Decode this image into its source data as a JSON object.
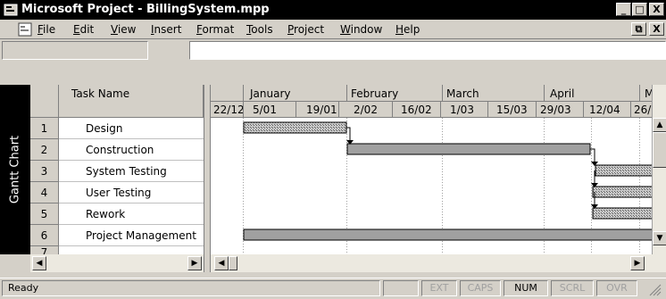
{
  "window": {
    "title": "Microsoft Project - BillingSystem.mpp",
    "caption_buttons": [
      "_",
      "□",
      "X"
    ]
  },
  "menu": {
    "items": [
      "File",
      "Edit",
      "View",
      "Insert",
      "Format",
      "Tools",
      "Project",
      "Window",
      "Help"
    ],
    "mdi_buttons": [
      "⧉",
      "X"
    ]
  },
  "view_bar": {
    "label": "Gantt Chart"
  },
  "table": {
    "header": "Task Name",
    "rows": [
      {
        "id": "1",
        "name": "Design"
      },
      {
        "id": "2",
        "name": "Construction"
      },
      {
        "id": "3",
        "name": "System Testing"
      },
      {
        "id": "4",
        "name": "User Testing"
      },
      {
        "id": "5",
        "name": "Rework"
      },
      {
        "id": "6",
        "name": "Project Management"
      },
      {
        "id": "7",
        "name": ""
      }
    ]
  },
  "timescale": {
    "months": [
      "January",
      "February",
      "March",
      "April",
      "M"
    ],
    "weeks": [
      "22/12",
      "5/01",
      "19/01",
      "2/02",
      "16/02",
      "1/03",
      "15/03",
      "29/03",
      "12/04",
      "26/"
    ]
  },
  "gantt_bars": [
    {
      "task": "Design",
      "start": "29/12",
      "end": "3/02"
    },
    {
      "task": "Construction",
      "start": "3/02",
      "end": "12/04"
    },
    {
      "task": "System Testing",
      "start": "14/04",
      "end": "beyond view"
    },
    {
      "task": "User Testing",
      "start": "14/04",
      "end": "beyond view"
    },
    {
      "task": "Rework",
      "start": "14/04",
      "end": "beyond view"
    },
    {
      "task": "Project Management",
      "start": "29/12",
      "end": "beyond view"
    }
  ],
  "status": {
    "text": "Ready",
    "indicators": [
      {
        "label": "EXT",
        "active": false
      },
      {
        "label": "CAPS",
        "active": false
      },
      {
        "label": "NUM",
        "active": true
      },
      {
        "label": "SCRL",
        "active": false
      },
      {
        "label": "OVR",
        "active": false
      }
    ]
  },
  "colors": {
    "title_bg": "#000000",
    "chrome": "#d4d0c8",
    "bar_fill": "#a0a0a0"
  }
}
